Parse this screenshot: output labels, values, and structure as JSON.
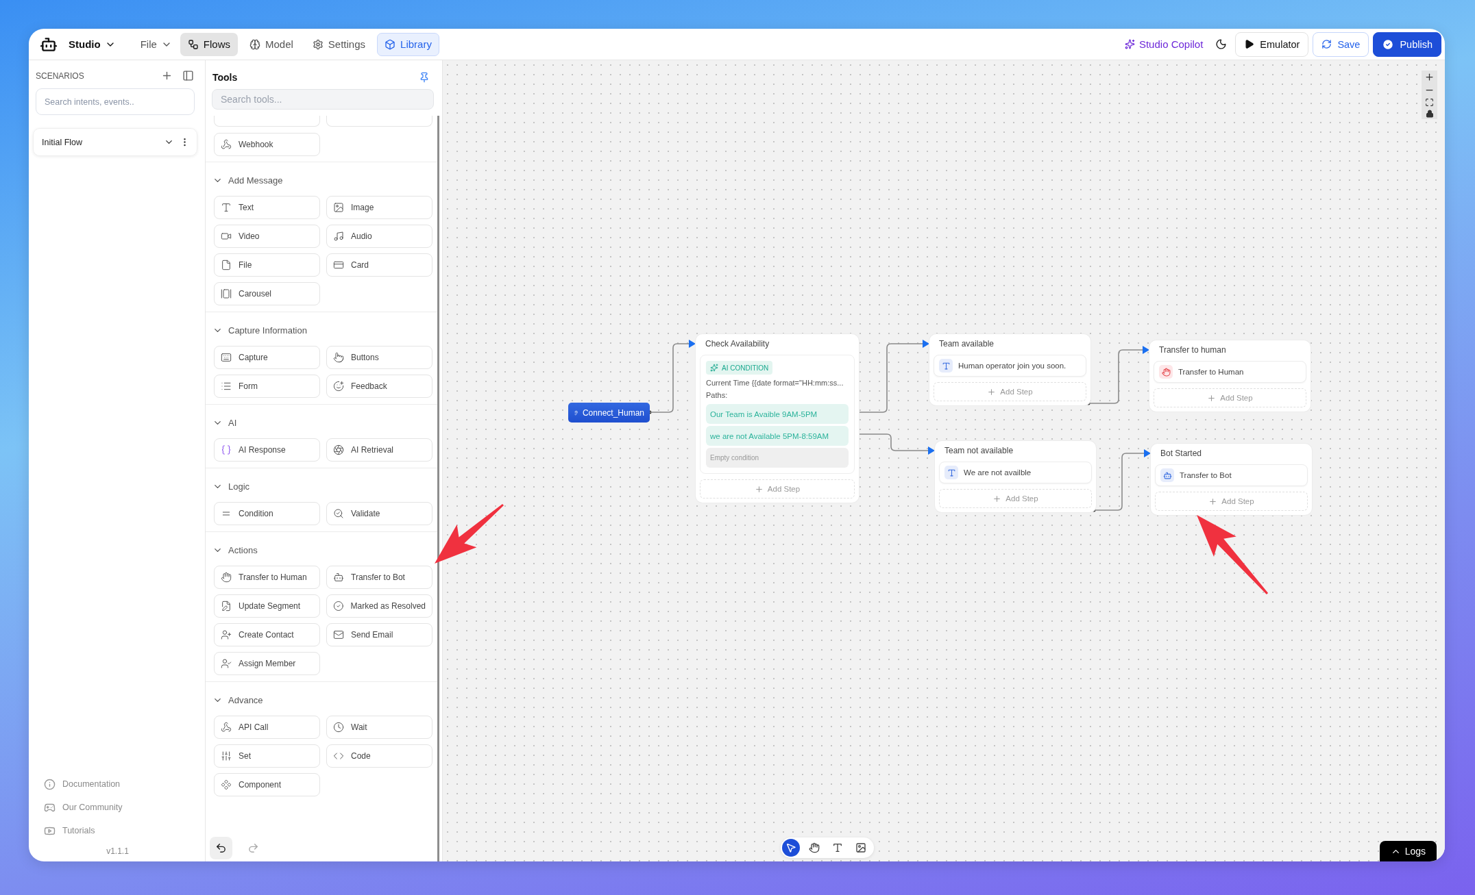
{
  "app": {
    "name": "Studio"
  },
  "file_menu": {
    "label": "File"
  },
  "tabs": [
    {
      "label": "Flows",
      "selected": true
    },
    {
      "label": "Model",
      "selected": false
    },
    {
      "label": "Settings",
      "selected": false
    }
  ],
  "library_toggle": {
    "label": "Library",
    "on": true
  },
  "actions": {
    "copilot": "Studio Copilot",
    "emulator": "Emulator",
    "save": "Save",
    "publish": "Publish"
  },
  "scenarios": {
    "title": "SCENARIOS",
    "search": {
      "placeholder": "Search intents, events.."
    },
    "flows": [
      {
        "name": "Initial Flow"
      }
    ],
    "links": [
      "Documentation",
      "Our Community",
      "Tutorials"
    ],
    "version": "v1.1.1"
  },
  "tools": {
    "title": "Tools",
    "search": {
      "placeholder": "Search tools..."
    },
    "clipped_items": [
      {
        "kind": "tool"
      },
      {
        "kind": "tool"
      }
    ],
    "top_items": [
      {
        "label": "Webhook"
      }
    ],
    "sections": [
      {
        "title": "Add Message",
        "expanded": true,
        "items": [
          {
            "label": "Text"
          },
          {
            "label": "Image"
          },
          {
            "label": "Video"
          },
          {
            "label": "Audio"
          },
          {
            "label": "File"
          },
          {
            "label": "Card"
          },
          {
            "label": "Carousel"
          }
        ]
      },
      {
        "title": "Capture Information",
        "expanded": true,
        "items": [
          {
            "label": "Capture"
          },
          {
            "label": "Buttons"
          },
          {
            "label": "Form"
          },
          {
            "label": "Feedback"
          }
        ]
      },
      {
        "title": "AI",
        "expanded": true,
        "items": [
          {
            "label": "AI Response"
          },
          {
            "label": "AI Retrieval"
          }
        ]
      },
      {
        "title": "Logic",
        "expanded": true,
        "items": [
          {
            "label": "Condition"
          },
          {
            "label": "Validate"
          }
        ]
      },
      {
        "title": "Actions",
        "expanded": true,
        "items": [
          {
            "label": "Transfer to Human"
          },
          {
            "label": "Transfer to Bot"
          },
          {
            "label": "Update Segment"
          },
          {
            "label": "Marked as Resolved"
          },
          {
            "label": "Create Contact"
          },
          {
            "label": "Send Email"
          },
          {
            "label": "Assign Member"
          }
        ]
      },
      {
        "title": "Advance",
        "expanded": true,
        "items": [
          {
            "label": "API Call"
          },
          {
            "label": "Wait"
          },
          {
            "label": "Set"
          },
          {
            "label": "Code"
          },
          {
            "label": "Component"
          }
        ]
      }
    ]
  },
  "history": {
    "undo": {
      "disabled": false
    },
    "redo": {
      "disabled": true
    }
  },
  "nodes": [
    {
      "kind": "start",
      "label": "Connect_Human"
    },
    {
      "kind": "condition",
      "title": "Check Availability",
      "badge": "AI CONDITION",
      "prompt": "Current Time {{date format=\"HH:mm:ss...",
      "paths_label": "Paths:",
      "paths": [
        {
          "kind": "path",
          "label": "Our Team is Avaible 9AM-5PM"
        },
        {
          "kind": "path",
          "label": "we are not Available 5PM-8:59AM"
        },
        {
          "kind": "empty",
          "label": "Empty condition"
        }
      ],
      "add_step": "Add Step"
    },
    {
      "kind": "block",
      "title": "Team available",
      "steps": [
        {
          "kind": "text",
          "label": "Human operator join you soon."
        }
      ],
      "add_step": "Add Step"
    },
    {
      "kind": "block",
      "title": "Team not available",
      "steps": [
        {
          "kind": "text",
          "label": "We are not availble"
        }
      ],
      "add_step": "Add Step"
    },
    {
      "kind": "block",
      "title": "Transfer to human",
      "steps": [
        {
          "kind": "human",
          "label": "Transfer to Human"
        }
      ],
      "add_step": "Add Step"
    },
    {
      "kind": "block",
      "title": "Bot Started",
      "steps": [
        {
          "kind": "bot",
          "label": "Transfer to Bot"
        }
      ],
      "add_step": "Add Step"
    }
  ],
  "canvas_tools": [
    {
      "selected": true
    },
    {
      "selected": false
    },
    {
      "selected": false
    },
    {
      "selected": false
    }
  ],
  "logs": {
    "label": "Logs"
  }
}
